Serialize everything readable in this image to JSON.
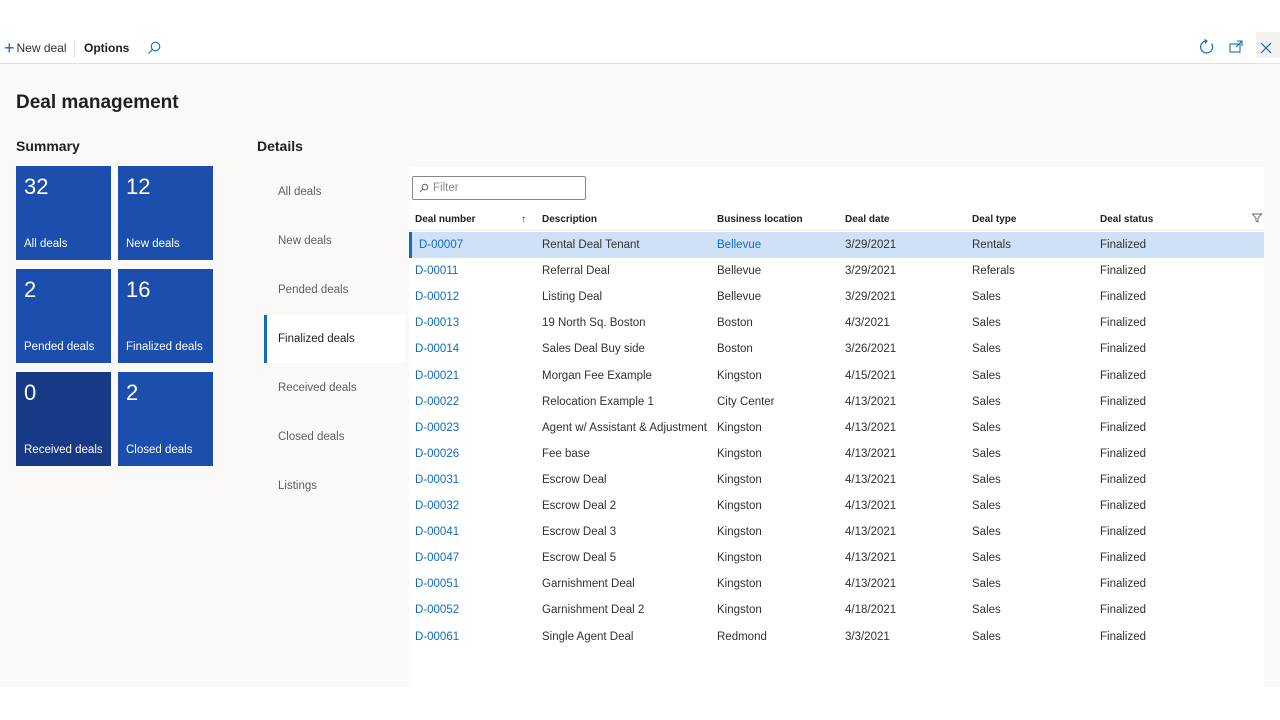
{
  "toolbar": {
    "new_deal_label": "New deal",
    "options_label": "Options"
  },
  "page_title": "Deal management",
  "summary": {
    "heading": "Summary",
    "tiles": [
      {
        "count": "32",
        "label": "All deals"
      },
      {
        "count": "12",
        "label": "New deals"
      },
      {
        "count": "2",
        "label": "Pended deals"
      },
      {
        "count": "16",
        "label": "Finalized deals"
      },
      {
        "count": "0",
        "label": "Received deals"
      },
      {
        "count": "2",
        "label": "Closed deals"
      }
    ]
  },
  "details": {
    "heading": "Details",
    "tabs": [
      "All deals",
      "New deals",
      "Pended deals",
      "Finalized deals",
      "Received deals",
      "Closed deals",
      "Listings"
    ],
    "active_tab": "Finalized deals"
  },
  "grid": {
    "filter_placeholder": "Filter",
    "columns": [
      "Deal number",
      "Description",
      "Business location",
      "Deal date",
      "Deal type",
      "Deal status"
    ],
    "rows": [
      [
        "D-00007",
        "Rental Deal Tenant",
        "Bellevue",
        "3/29/2021",
        "Rentals",
        "Finalized"
      ],
      [
        "D-00011",
        "Referral Deal",
        "Bellevue",
        "3/29/2021",
        "Referals",
        "Finalized"
      ],
      [
        "D-00012",
        "Listing Deal",
        "Bellevue",
        "3/29/2021",
        "Sales",
        "Finalized"
      ],
      [
        "D-00013",
        "19 North Sq. Boston",
        "Boston",
        "4/3/2021",
        "Sales",
        "Finalized"
      ],
      [
        "D-00014",
        "Sales Deal Buy side",
        "Boston",
        "3/26/2021",
        "Sales",
        "Finalized"
      ],
      [
        "D-00021",
        "Morgan Fee Example",
        "Kingston",
        "4/15/2021",
        "Sales",
        "Finalized"
      ],
      [
        "D-00022",
        "Relocation Example 1",
        "City Center",
        "4/13/2021",
        "Sales",
        "Finalized"
      ],
      [
        "D-00023",
        "Agent w/ Assistant & Adjustment",
        "Kingston",
        "4/13/2021",
        "Sales",
        "Finalized"
      ],
      [
        "D-00026",
        "Fee base",
        "Kingston",
        "4/13/2021",
        "Sales",
        "Finalized"
      ],
      [
        "D-00031",
        "Escrow Deal",
        "Kingston",
        "4/13/2021",
        "Sales",
        "Finalized"
      ],
      [
        "D-00032",
        "Escrow Deal 2",
        "Kingston",
        "4/13/2021",
        "Sales",
        "Finalized"
      ],
      [
        "D-00041",
        "Escrow Deal 3",
        "Kingston",
        "4/13/2021",
        "Sales",
        "Finalized"
      ],
      [
        "D-00047",
        "Escrow Deal 5",
        "Kingston",
        "4/13/2021",
        "Sales",
        "Finalized"
      ],
      [
        "D-00051",
        "Garnishment Deal",
        "Kingston",
        "4/13/2021",
        "Sales",
        "Finalized"
      ],
      [
        "D-00052",
        "Garnishment Deal 2",
        "Kingston",
        "4/18/2021",
        "Sales",
        "Finalized"
      ],
      [
        "D-00061",
        "Single Agent Deal",
        "Redmond",
        "3/3/2021",
        "Sales",
        "Finalized"
      ]
    ],
    "selected_row": 0
  },
  "icons": {
    "new": "plus-icon",
    "search": "search-icon",
    "refresh": "refresh-icon",
    "popout": "open-in-new-window-icon",
    "close": "close-icon",
    "sort": "sort-ascending-icon",
    "filter": "funnel-icon"
  },
  "colors": {
    "tile": "#1c4fad",
    "tile_dark": "#163a85",
    "accent": "#0f6cbd",
    "selected_row": "#cfe1f7"
  }
}
